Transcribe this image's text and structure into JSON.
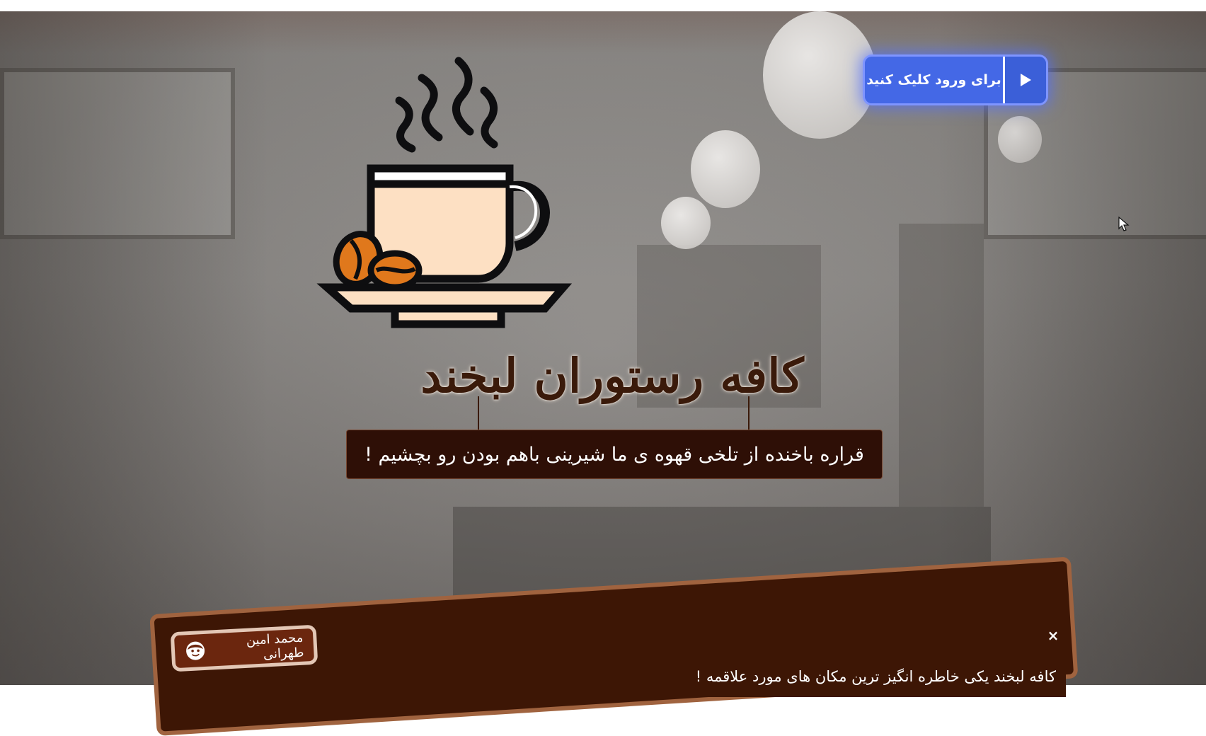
{
  "header": {
    "enter_button": {
      "label": "برای ورود کلیک کنید",
      "icon": "play-icon",
      "color": "#4468e6"
    }
  },
  "hero": {
    "logo_icon": "coffee-cup-icon",
    "title": "کافه رستوران لبخند",
    "tagline": "قراره باخنده از تلخی قهوه ی ما شیرینی باهم بودن رو بچشیم !"
  },
  "footer": {
    "author_name": "محمد امین طهرانی",
    "author_icon": "avatar-icon",
    "close_label": "×",
    "message": "کافه لبخند یکی خاطره انگیز ترین مکان های مورد علاقمه !",
    "accent": "#3d1605"
  }
}
